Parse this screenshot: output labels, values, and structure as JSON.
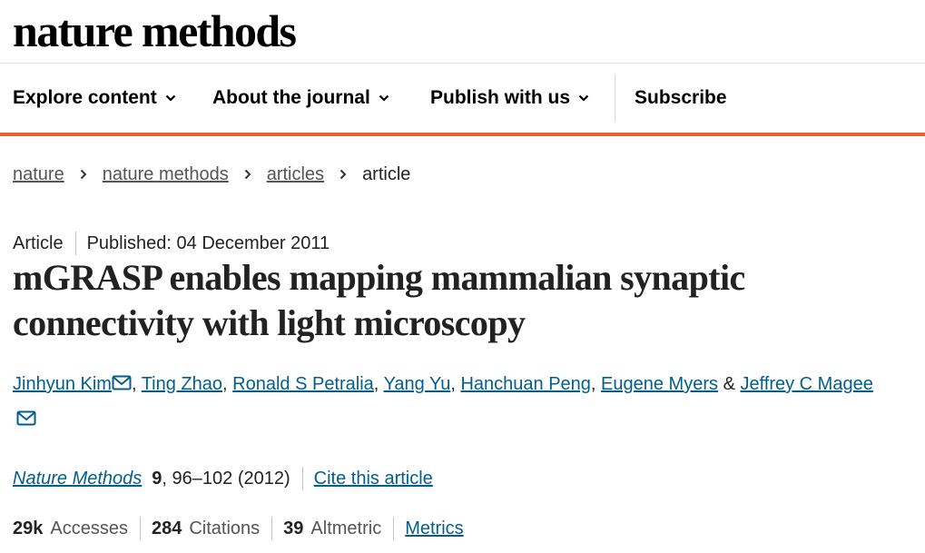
{
  "header": {
    "logo_text": "nature methods"
  },
  "nav": {
    "items": [
      {
        "label": "Explore content"
      },
      {
        "label": "About the journal"
      },
      {
        "label": "Publish with us"
      }
    ],
    "subscribe_label": "Subscribe"
  },
  "breadcrumb": {
    "items": [
      "nature",
      "nature methods",
      "articles"
    ],
    "current": "article"
  },
  "article": {
    "type": "Article",
    "published": "Published: 04 December 2011",
    "title": "mGRASP enables mapping mammalian synaptic connectivity with light microscopy",
    "authors": [
      "Jinhyun Kim",
      "Ting Zhao",
      "Ronald S Petralia",
      "Yang Yu",
      "Hanchuan Peng",
      "Eugene Myers",
      "Jeffrey C Magee"
    ],
    "author_separator": ", ",
    "author_last_separator": " & ",
    "journal": "Nature Methods",
    "volume": "9",
    "pages_year": ", 96–102 (2012)",
    "cite_label": "Cite this article"
  },
  "metrics": {
    "accesses_value": "29k",
    "accesses_label": "Accesses",
    "citations_value": "284",
    "citations_label": "Citations",
    "altmetric_value": "39",
    "altmetric_label": "Altmetric",
    "link_label": "Metrics"
  },
  "icons": {
    "chevron": "chevron-down-icon",
    "breadcrumb": "chevron-right-icon",
    "email": "email-icon"
  },
  "colors": {
    "accent_orange": "#e6602c",
    "link_blue": "#025e8d",
    "text": "#222222"
  }
}
